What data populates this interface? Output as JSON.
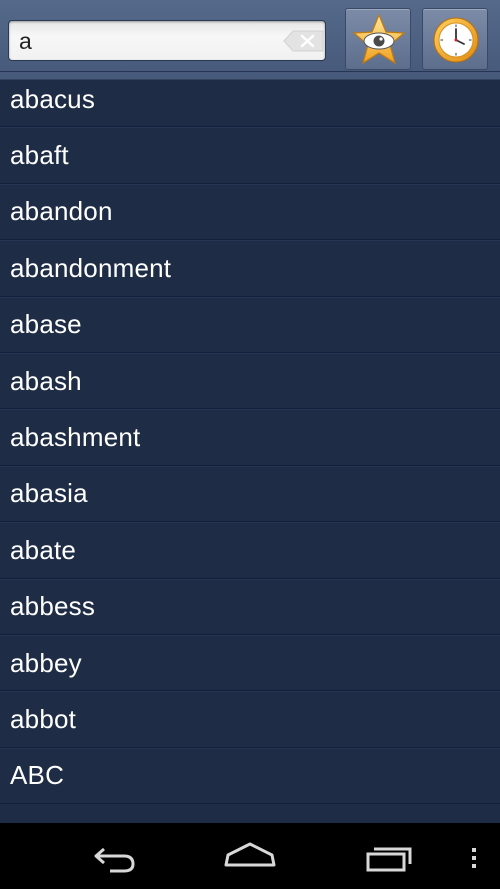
{
  "search": {
    "value": "a"
  },
  "toolbar": {
    "favorites_icon": "star-eye-icon",
    "history_icon": "clock-icon"
  },
  "words": [
    "abacus",
    "abaft",
    "abandon",
    "abandonment",
    "abase",
    "abash",
    "abashment",
    "abasia",
    "abate",
    "abbess",
    "abbey",
    "abbot",
    "ABC"
  ],
  "navbar": {
    "back_icon": "back-icon",
    "home_icon": "home-icon",
    "recents_icon": "recent-apps-icon",
    "menu_icon": "overflow-menu-icon"
  },
  "colors": {
    "list_background": "#1e2c45",
    "topbar": "#4f6384",
    "text": "#ffffff"
  }
}
